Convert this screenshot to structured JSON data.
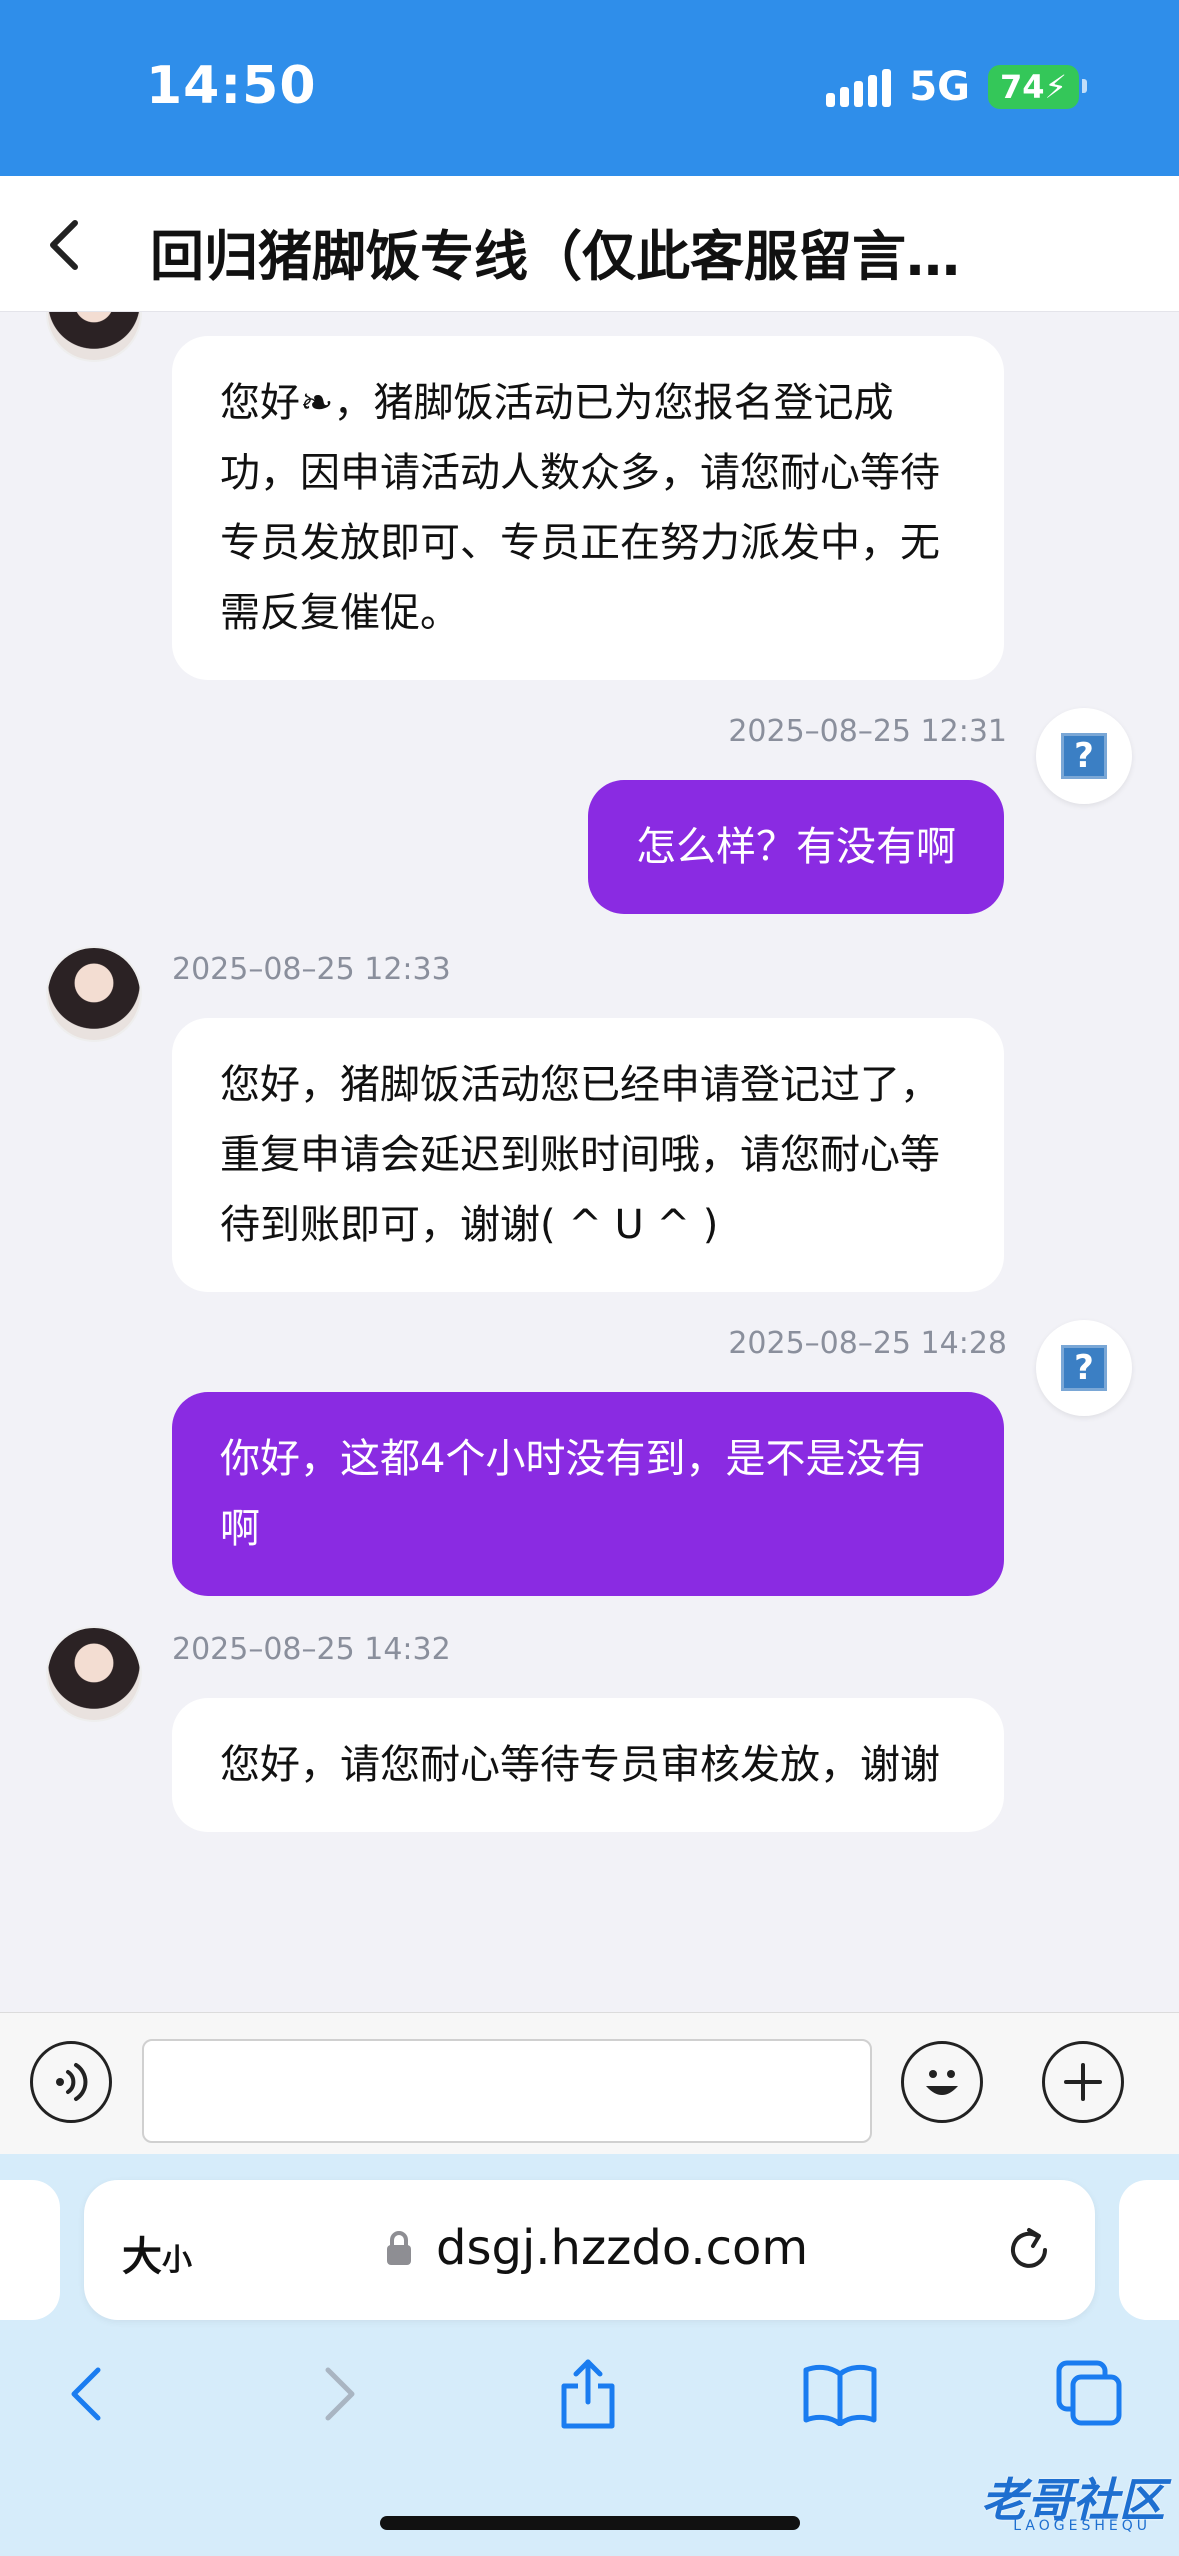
{
  "status_bar": {
    "time": "14:50",
    "network": "5G",
    "battery": "74"
  },
  "header": {
    "title": "回归猪脚饭专线（仅此客服留言…"
  },
  "messages": [
    {
      "direction": "in",
      "timestamp": "",
      "text": "您好❧，猪脚饭活动已为您报名登记成功，因申请活动人数众多，请您耐心等待专员发放即可、专员正在努力派发中，无需反复催促。"
    },
    {
      "direction": "out",
      "timestamp": "2025–08–25 12:31",
      "text": "怎么样？有没有啊"
    },
    {
      "direction": "in",
      "timestamp": "2025–08–25 12:33",
      "text": "您好，猪脚饭活动您已经申请登记过了，重复申请会延迟到账时间哦，请您耐心等待到账即可，谢谢( ^ U ^ )"
    },
    {
      "direction": "out",
      "timestamp": "2025–08–25 14:28",
      "text": "你好，这都4个小时没有到，是不是没有啊"
    },
    {
      "direction": "in",
      "timestamp": "2025–08–25 14:32",
      "text": "您好，请您耐心等待专员审核发放，谢谢"
    }
  ],
  "input": {
    "placeholder": ""
  },
  "browser": {
    "text_size_label": "大",
    "text_size_small": "小",
    "url": "dsgj.hzzdo.com"
  },
  "watermark": {
    "text": "老哥社区",
    "sub": "LAOGESHEQU"
  },
  "colors": {
    "status_bar": "#2f8eea",
    "outgoing_bubble": "#8a2be2",
    "incoming_bubble": "#ffffff",
    "chat_background": "#f2f2f7",
    "browser_bar": "#d6ecfa"
  }
}
